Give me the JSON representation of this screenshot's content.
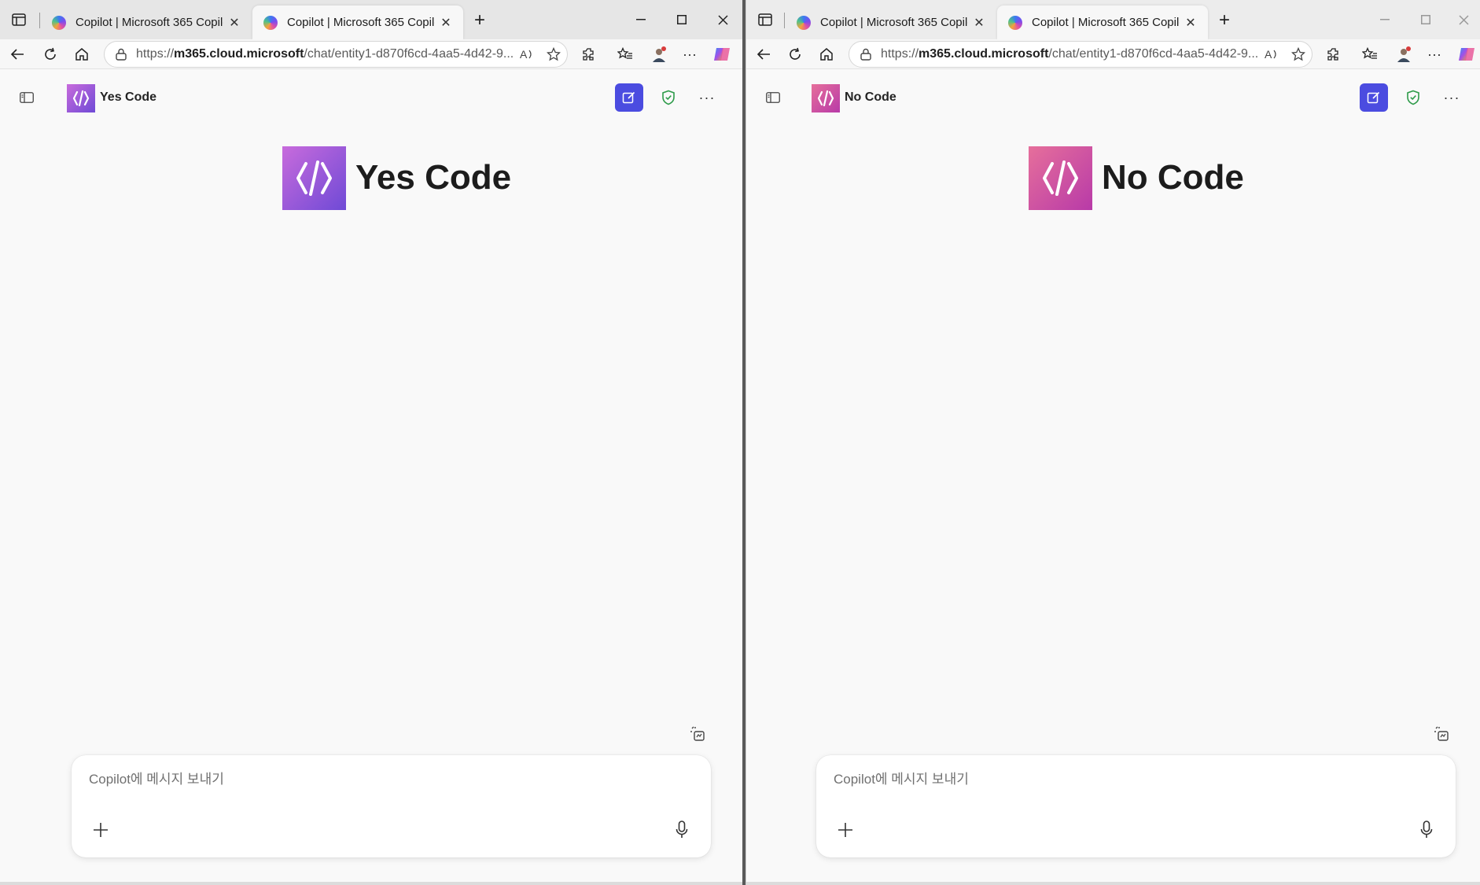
{
  "windows": [
    {
      "id": "left",
      "tabs": [
        {
          "title": "Copilot | Microsoft 365 Copilot",
          "active": false
        },
        {
          "title": "Copilot | Microsoft 365 Copilot",
          "active": true
        }
      ],
      "url": {
        "prefix": "https://",
        "host": "m365.cloud.microsoft",
        "path": "/chat/entity1-d870f6cd-4aa5-4d42-9..."
      },
      "agent": {
        "name": "Yes Code",
        "color_from": "#c86bdc",
        "color_to": "#6f4ad6"
      },
      "hero_title": "Yes Code",
      "composer": {
        "placeholder": "Copilot에 메시지 보내기"
      }
    },
    {
      "id": "right",
      "tabs": [
        {
          "title": "Copilot | Microsoft 365 Copilot",
          "active": false
        },
        {
          "title": "Copilot | Microsoft 365 Copilot",
          "active": true
        }
      ],
      "url": {
        "prefix": "https://",
        "host": "m365.cloud.microsoft",
        "path": "/chat/entity1-d870f6cd-4aa5-4d42-9..."
      },
      "agent": {
        "name": "No Code",
        "color_from": "#e66f9b",
        "color_to": "#b83aa8"
      },
      "hero_title": "No Code",
      "composer": {
        "placeholder": "Copilot에 메시지 보내기"
      }
    }
  ],
  "colors": {
    "new_chat_button": "#4b4ce0",
    "shield": "#2e9b4a"
  }
}
